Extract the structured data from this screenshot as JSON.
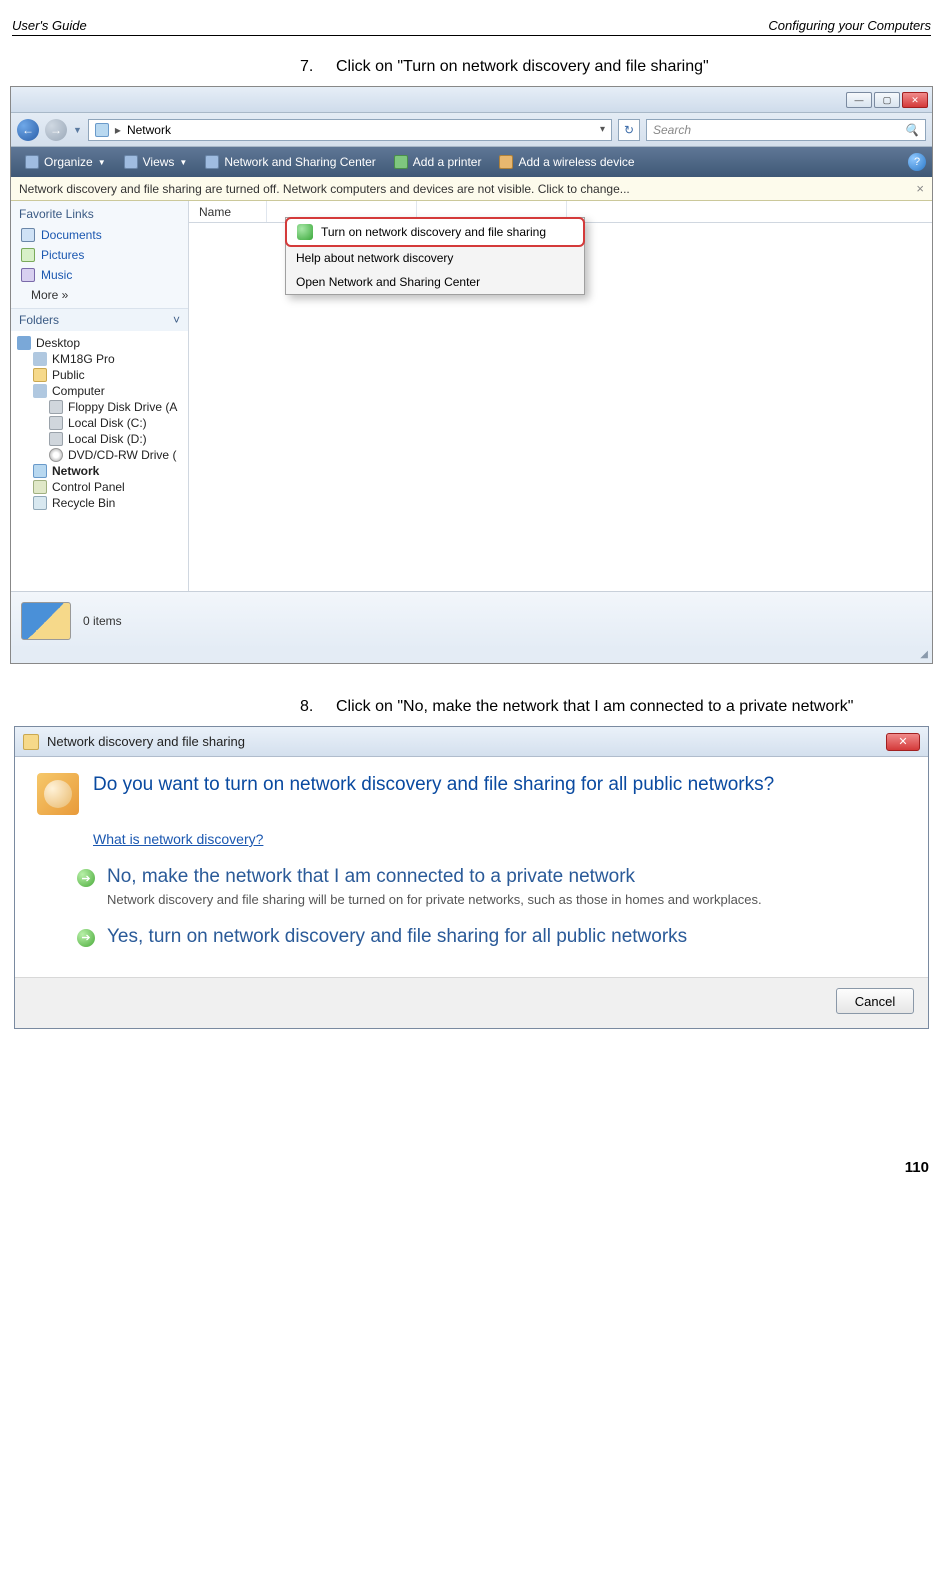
{
  "page": {
    "header_left": "User's Guide",
    "header_right": "Configuring your Computers",
    "page_number": "110"
  },
  "step7": {
    "num": "7.",
    "text": "Click on \"Turn on network discovery and file sharing\""
  },
  "step8": {
    "num": "8.",
    "text": "Click on \"No, make the network that I am connected to a private network\""
  },
  "explorer": {
    "titlebar": {
      "min": "—",
      "max": "▢",
      "close": "✕"
    },
    "nav": {
      "back": "←",
      "fwd": "→"
    },
    "address": {
      "root_icon_alt": "network-icon",
      "sep": "▸",
      "path": "Network",
      "drop": "▾",
      "refresh": "↻"
    },
    "search": {
      "placeholder": "Search",
      "icon": "🔍"
    },
    "toolbar": {
      "organize": "Organize",
      "views": "Views",
      "nsc": "Network and Sharing Center",
      "add_printer": "Add a printer",
      "add_wireless": "Add a wireless device",
      "help": "?"
    },
    "infobar": {
      "text": "Network discovery and file sharing are turned off. Network computers and devices are not visible. Click to change...",
      "close": "×"
    },
    "columns": {
      "name": "Name"
    },
    "dropdown": {
      "item1": "Turn on network discovery and file sharing",
      "item2": "Help about network discovery",
      "item3": "Open Network and Sharing Center"
    },
    "sidebar": {
      "fav_heading": "Favorite Links",
      "documents": "Documents",
      "pictures": "Pictures",
      "music": "Music",
      "more": "More  »",
      "folders_heading": "Folders",
      "folders_caret": "˅",
      "tree": {
        "desktop": "Desktop",
        "km18g": "KM18G Pro",
        "public": "Public",
        "computer": "Computer",
        "floppy": "Floppy Disk Drive (A",
        "localc": "Local Disk (C:)",
        "locald": "Local Disk (D:)",
        "dvd": "DVD/CD-RW Drive (",
        "network": "Network",
        "cpanel": "Control Panel",
        "recycle": "Recycle Bin"
      }
    },
    "status": {
      "text": "0 items"
    }
  },
  "dialog": {
    "title": "Network discovery and file sharing",
    "close": "✕",
    "heading": "Do you want to turn on network discovery and file sharing for all public networks?",
    "link": "What is network discovery?",
    "opt1": {
      "title": "No, make the network that I am connected to a private network",
      "sub": "Network discovery and file sharing will be turned on for private networks, such as those in homes and workplaces."
    },
    "opt2": {
      "title": "Yes, turn on network discovery and file sharing for all public networks"
    },
    "cancel": "Cancel"
  }
}
